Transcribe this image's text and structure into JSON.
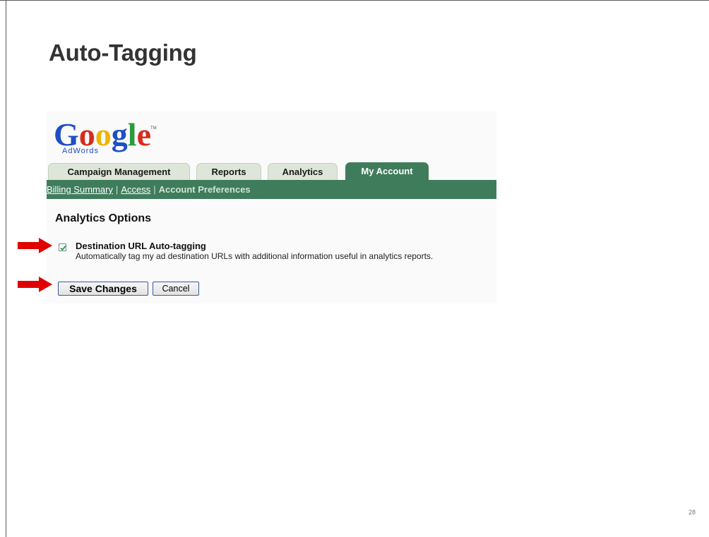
{
  "slide": {
    "title": "Auto-Tagging",
    "page_number": "28"
  },
  "logo": {
    "brand": "Google",
    "product": "AdWords",
    "tm": "TM"
  },
  "tabs": [
    {
      "label": "Campaign Management",
      "active": false
    },
    {
      "label": "Reports",
      "active": false
    },
    {
      "label": "Analytics",
      "active": false
    },
    {
      "label": "My Account",
      "active": true
    }
  ],
  "subnav": {
    "items": [
      {
        "label": "Billing Summary",
        "link": true
      },
      {
        "label": "Access",
        "link": true
      },
      {
        "label": "Account Preferences",
        "link": false
      }
    ],
    "separator": "|"
  },
  "analytics": {
    "heading": "Analytics Options",
    "option_title": "Destination URL Auto-tagging",
    "option_description": "Automatically tag my ad destination URLs with additional information useful in analytics reports.",
    "checked": true
  },
  "buttons": {
    "save": "Save Changes",
    "cancel": "Cancel"
  },
  "colors": {
    "nav_green": "#3f7c5c",
    "tab_inactive": "#dde6d8",
    "arrow_red": "#e00000",
    "logo_blue": "#1f4fc1",
    "logo_red": "#d62c1a",
    "logo_yellow": "#f0b400",
    "logo_green": "#2a9a3e"
  }
}
